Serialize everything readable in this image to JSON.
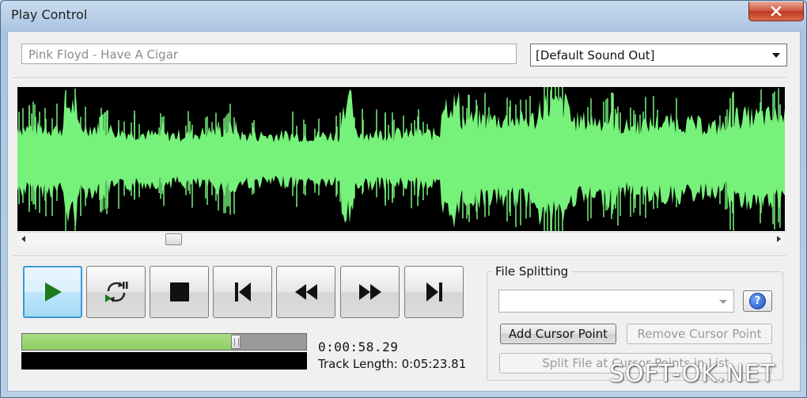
{
  "window": {
    "title": "Play Control"
  },
  "track": {
    "name": "Pink Floyd - Have A Cigar"
  },
  "output_device": {
    "selected": "[Default Sound Out]"
  },
  "waveform": {
    "color": "#76f27a",
    "background": "#000000",
    "scroll_position": 0.18
  },
  "transport": {
    "buttons": [
      {
        "name": "play-button",
        "icon": "play-icon",
        "active": true
      },
      {
        "name": "loop-play-button",
        "icon": "loop-icon",
        "active": false
      },
      {
        "name": "stop-button",
        "icon": "stop-icon",
        "active": false
      },
      {
        "name": "skip-to-start-button",
        "icon": "skip-start-icon",
        "active": false
      },
      {
        "name": "rewind-button",
        "icon": "rewind-icon",
        "active": false
      },
      {
        "name": "fast-forward-button",
        "icon": "fast-forward-icon",
        "active": false
      },
      {
        "name": "skip-to-end-button",
        "icon": "skip-end-icon",
        "active": false
      }
    ],
    "accent": "#1d7a1d"
  },
  "position": {
    "progress_fraction": 0.74,
    "current_time": "0:00:58.29",
    "track_length": "Track Length: 0:05:23.81"
  },
  "file_splitting": {
    "label": "File Splitting",
    "split_points_value": "",
    "add_cursor_point": "Add Cursor Point",
    "remove_cursor_point": "Remove Cursor Point",
    "split_file": "Split File at Cursor Points in List",
    "help": "?"
  },
  "watermark": {
    "text": "SOFT-OK.NET"
  }
}
